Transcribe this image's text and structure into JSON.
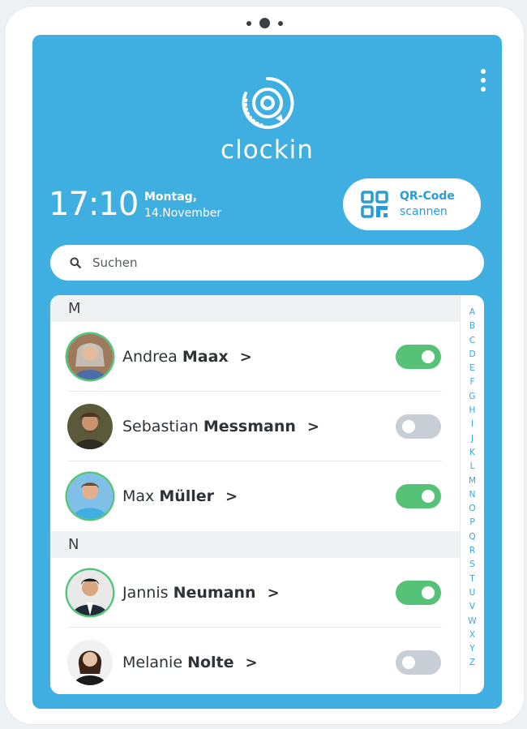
{
  "app": {
    "logo_text": "clockin"
  },
  "clock": {
    "time": "17:10",
    "weekday": "Montag,",
    "date": "14.November"
  },
  "qr_button": {
    "line1": "QR-Code",
    "line2": "scannen"
  },
  "search": {
    "placeholder": "Suchen"
  },
  "sections": [
    {
      "letter": "M",
      "people": [
        {
          "first": "Andrea",
          "last": "Maax",
          "chevron": ">",
          "clocked_in": true
        },
        {
          "first": "Sebastian",
          "last": "Messmann",
          "chevron": ">",
          "clocked_in": false
        },
        {
          "first": "Max",
          "last": "Müller",
          "chevron": ">",
          "clocked_in": true
        }
      ]
    },
    {
      "letter": "N",
      "people": [
        {
          "first": "Jannis",
          "last": "Neumann",
          "chevron": ">",
          "clocked_in": true
        },
        {
          "first": "Melanie",
          "last": "Nolte",
          "chevron": ">",
          "clocked_in": false
        }
      ]
    }
  ],
  "alphabet": [
    "A",
    "B",
    "C",
    "D",
    "E",
    "F",
    "G",
    "H",
    "I",
    "J",
    "K",
    "L",
    "M",
    "N",
    "O",
    "P",
    "Q",
    "R",
    "S",
    "T",
    "U",
    "V",
    "W",
    "X",
    "Y",
    "Z"
  ],
  "colors": {
    "brand": "#3faee0",
    "toggle_on": "#56c278",
    "toggle_off": "#c7ced6",
    "accent_text": "#2b9bd5"
  },
  "icons": {
    "menu": "more-vertical-icon",
    "logo": "clockin-logo-icon",
    "qr": "qr-code-icon",
    "search": "search-icon",
    "chevron": "chevron-right-icon"
  }
}
